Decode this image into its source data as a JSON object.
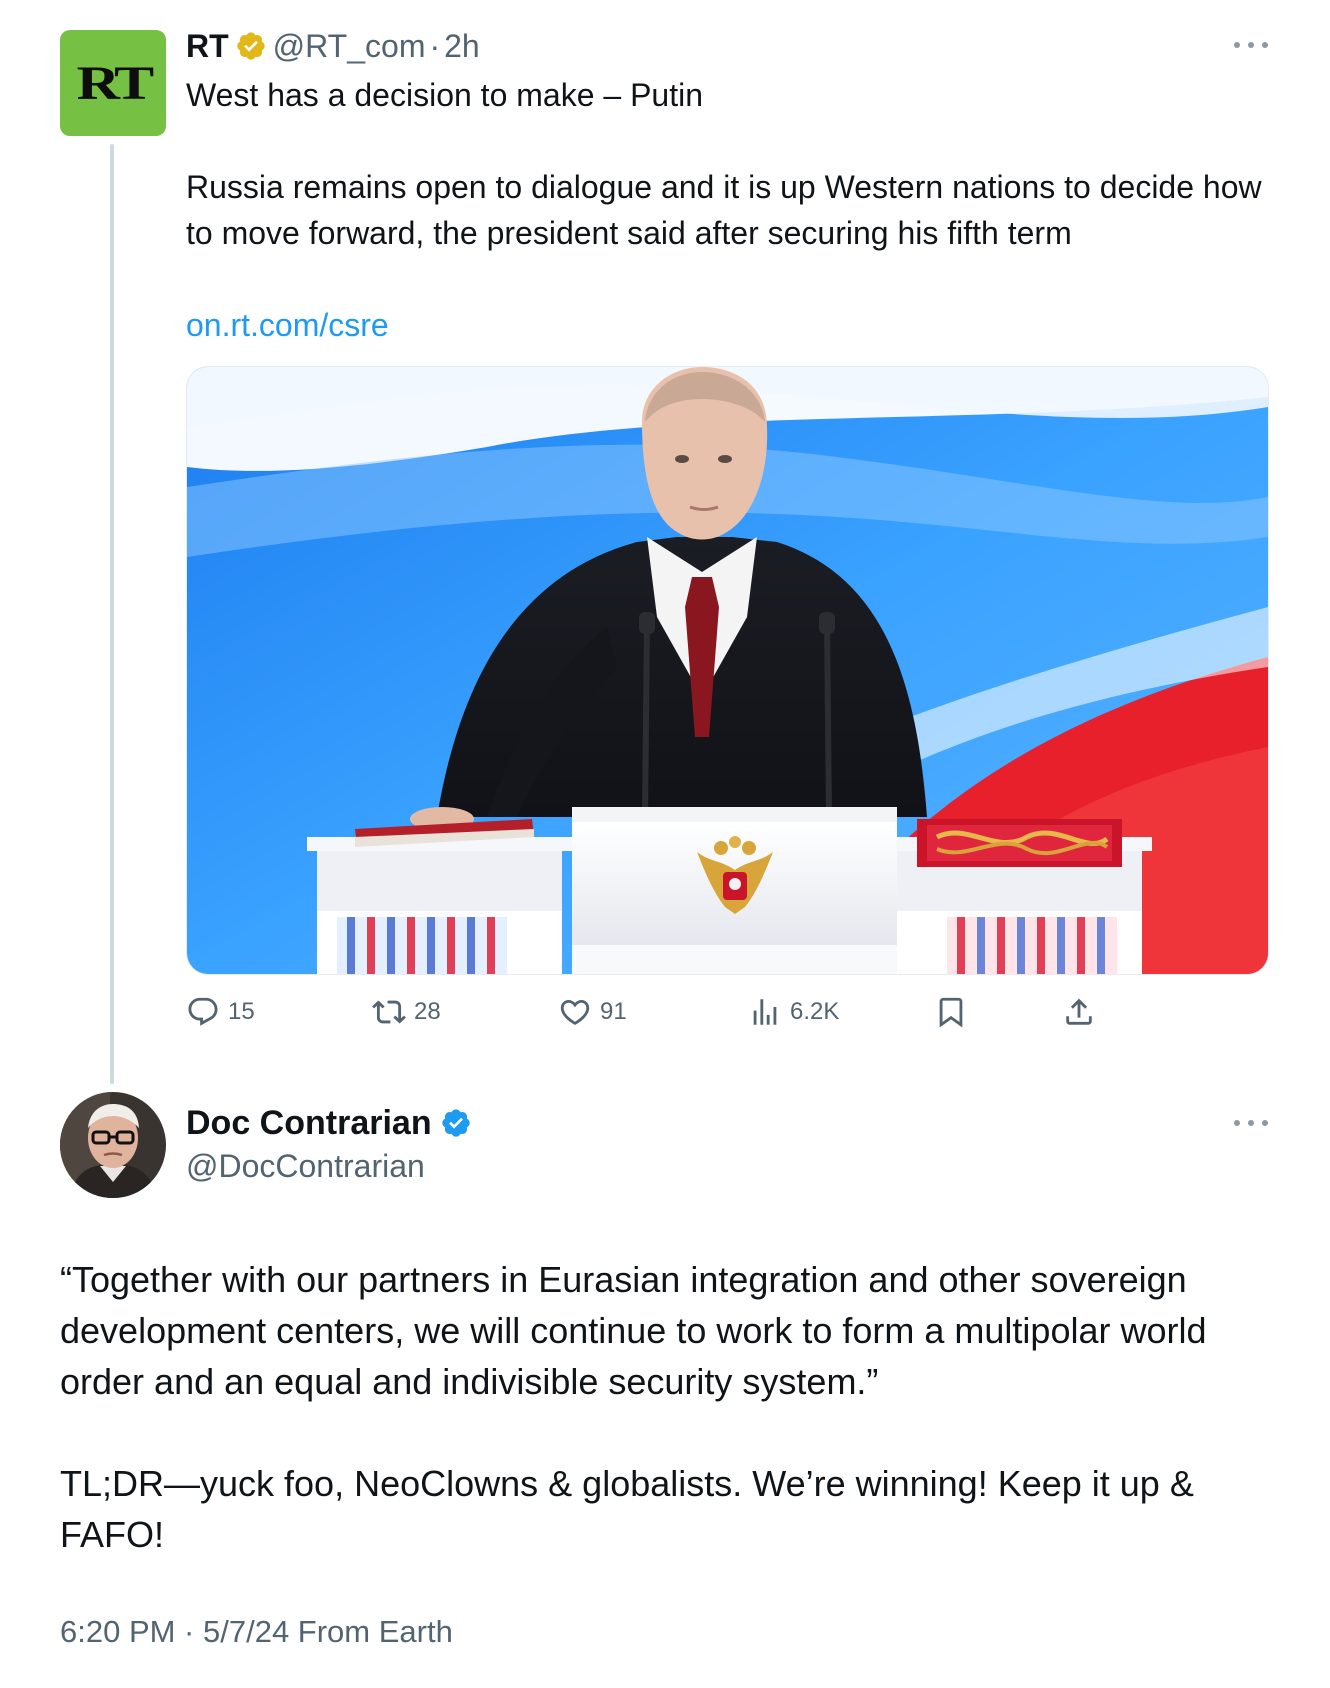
{
  "parent_tweet": {
    "avatar_text": "RT",
    "name": "RT",
    "handle": "@RT_com",
    "separator": "·",
    "time": "2h",
    "headline": "West has a decision to make – Putin",
    "summary": "Russia remains open to dialogue and it is up Western nations to decide how to move forward, the president said after securing his fifth term",
    "link": "on.rt.com/csre",
    "media_icon": "photo-inauguration-podium",
    "actions": {
      "replies": "15",
      "reposts": "28",
      "likes": "91",
      "views": "6.2K"
    }
  },
  "reply_tweet": {
    "name": "Doc Contrarian",
    "handle": "@DocContrarian",
    "quote": "“Together with our partners in Eurasian integration and other sovereign development centers, we will continue to work to form a multipolar world order and an equal and indivisible security system.”",
    "comment": "TL;DR—yuck foo, NeoClowns & globalists. We’re winning! Keep it up & FAFO!",
    "timestamp": "6:20 PM · 5/7/24 From Earth"
  },
  "colors": {
    "text": "#0f1419",
    "secondary": "#536471",
    "link": "#1d9bf0",
    "thread_line": "#cfd9de",
    "rt_green": "#76c043",
    "verified_gold": "#e2b719",
    "verified_blue": "#1d9bf0"
  }
}
